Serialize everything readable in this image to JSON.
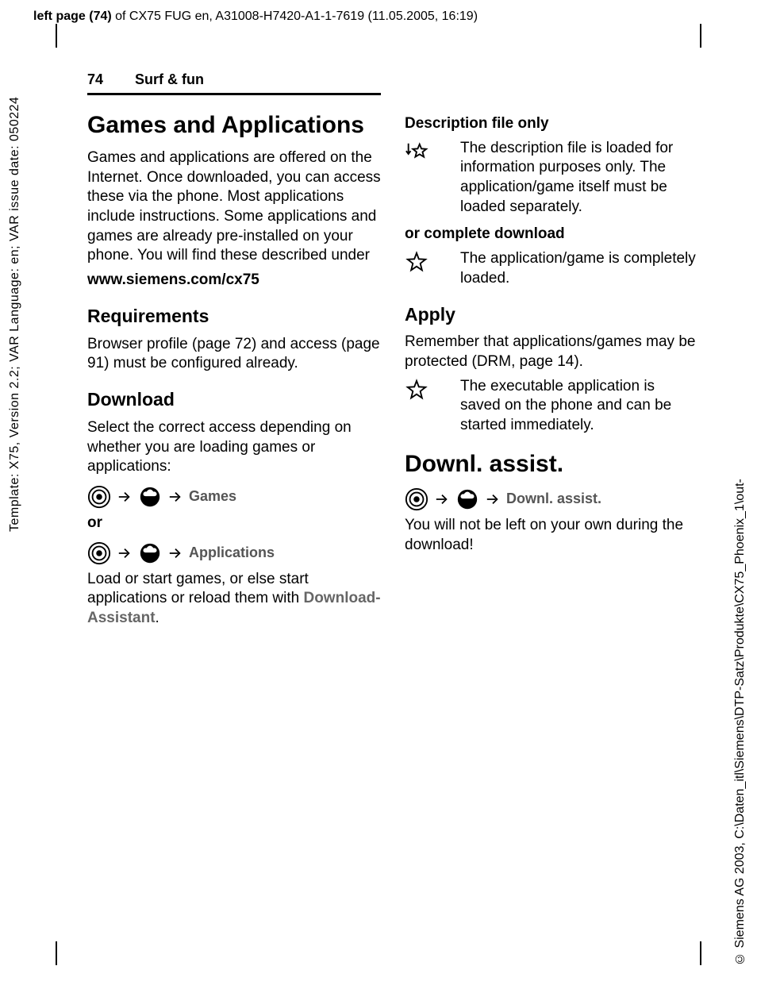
{
  "top": {
    "bold": "left page (74)",
    "rest": " of CX75 FUG en, A31008-H7420-A1-1-7619 (11.05.2005, 16:19)"
  },
  "side_left": "Template: X75, Version 2.2; VAR Language: en; VAR issue date: 050224",
  "side_right": "© Siemens AG 2003, C:\\Daten_itl\\Siemens\\DTP-Satz\\Produkte\\CX75_Phoenix_1\\out-",
  "header": {
    "page_number": "74",
    "section": "Surf & fun"
  },
  "left": {
    "h1": "Games and Applications",
    "intro": "Games and applications are offered on the Internet. Once downloaded, you can access these via the phone. Most applications include instructions. Some applications and games are already pre-installed on your phone. You will find these described under",
    "url": "www.siemens.com/cx75",
    "req_h": "Requirements",
    "req_p": "Browser profile (page 72) and access (page 91) must be configured already.",
    "dl_h": "Download",
    "dl_p": "Select the correct access depending on whether you are loading games or applications:",
    "nav_games": "Games",
    "or": "or",
    "nav_apps": "Applications",
    "load_p": "Load or start games, or else start applications or reload them with ",
    "dl_assist_lbl": "Download-Assistant"
  },
  "right": {
    "desc_h": "Description file only",
    "desc_p": "The description file is loaded for information purposes only. The application/game itself must be loaded separately.",
    "comp_h": "or complete download",
    "comp_p": "The application/game is completely loaded.",
    "apply_h": "Apply",
    "apply_p": "Remember that applications/games may be protected (DRM, page 14).",
    "apply_def": "The executable application is saved on the phone and can be started immediately.",
    "da_h": "Downl. assist.",
    "da_nav": "Downl. assist.",
    "da_p": "You will not be left on your own during the download!"
  }
}
